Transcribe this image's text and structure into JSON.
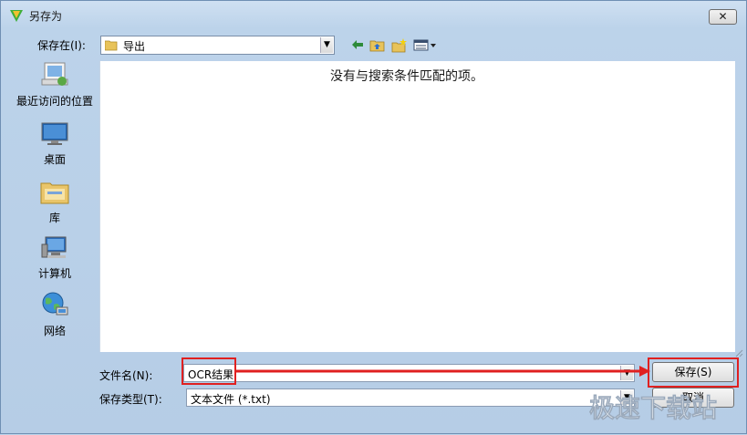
{
  "window": {
    "title": "另存为",
    "close_label": "✕"
  },
  "toolbar": {
    "save_in_label": "保存在(I):",
    "location": "导出"
  },
  "places": [
    {
      "name": "recent",
      "label": "最近访问的位置"
    },
    {
      "name": "desktop",
      "label": "桌面"
    },
    {
      "name": "libraries",
      "label": "库"
    },
    {
      "name": "computer",
      "label": "计算机"
    },
    {
      "name": "network",
      "label": "网络"
    }
  ],
  "file_list": {
    "empty_message": "没有与搜索条件匹配的项。"
  },
  "form": {
    "filename_label": "文件名(N):",
    "filename_value": "OCR结果",
    "filetype_label": "保存类型(T):",
    "filetype_value": "文本文件 (*.txt)"
  },
  "buttons": {
    "save_label": "保存(S)",
    "cancel_label": "取消"
  },
  "watermark": {
    "brand": "极速下载站"
  },
  "colors": {
    "highlight": "#e02020",
    "accent": "#3a7bd5"
  }
}
